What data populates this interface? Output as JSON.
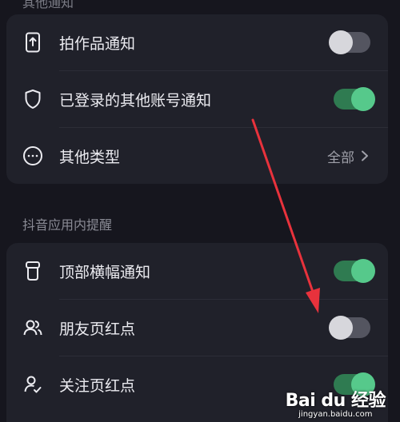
{
  "top_section_title_partial": "其他通知",
  "card1": {
    "rows": [
      {
        "label": "拍作品通知",
        "icon": "upload-phone-icon",
        "toggle": "off"
      },
      {
        "label": "已登录的其他账号通知",
        "icon": "shield-icon",
        "toggle": "on"
      },
      {
        "label": "其他类型",
        "icon": "more-circle-icon",
        "value": "全部"
      }
    ]
  },
  "section2": {
    "title": "抖音应用内提醒",
    "rows": [
      {
        "label": "顶部横幅通知",
        "icon": "banner-icon",
        "toggle": "on"
      },
      {
        "label": "朋友页红点",
        "icon": "friends-icon",
        "toggle": "off"
      },
      {
        "label": "关注页红点",
        "icon": "follow-user-icon",
        "toggle": "on"
      }
    ]
  },
  "watermark": {
    "logo": "Bai du 经验",
    "url": "jingyan.baidu.com"
  },
  "colors": {
    "background": "#16161e",
    "card": "#20212a",
    "toggle_on_track": "#2f7b51",
    "toggle_on_knob": "#56c98b",
    "toggle_off_track": "#545560",
    "toggle_off_knob": "#d7d7dc",
    "annotation_arrow": "#e8323c"
  }
}
